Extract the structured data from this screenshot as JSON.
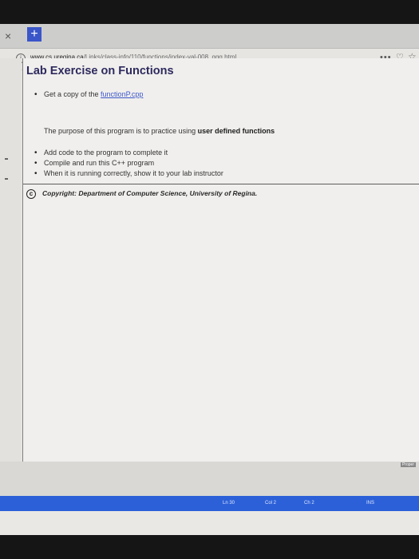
{
  "browser": {
    "tab_close": "×",
    "new_tab": "+",
    "url_host": "www.cs.uregina.ca",
    "url_path": "/Links/class-info/110/functions/index-val-008_ggg.html",
    "more": "•••",
    "pocket": "♡",
    "star": "☆"
  },
  "page": {
    "title": "Lab Exercise on Functions",
    "item1_prefix": "Get a copy of the ",
    "item1_link": "functionP.cpp",
    "purpose_prefix": "The purpose of this program is to practice using ",
    "purpose_bold": "user defined functions",
    "steps": [
      "Add code to the program to complete it",
      "Compile and run this C++ program",
      "When it is running correctly, show it to your lab instructor"
    ],
    "copyright_symbol": "c",
    "copyright_text": "Copyright: Department of Computer Science, University of Regina."
  },
  "editor": {
    "side_label": "Proper",
    "status": {
      "line": "Ln 30",
      "col": "Col 2",
      "ch": "Ch 2",
      "mode": "INS"
    }
  }
}
